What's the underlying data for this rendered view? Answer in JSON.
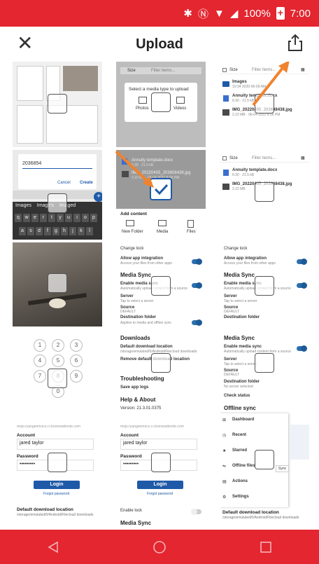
{
  "status_bar": {
    "battery": "100%",
    "time": "7:00",
    "icons": [
      "bluetooth-icon",
      "nfc-icon",
      "wifi-icon",
      "signal-icon",
      "battery-icon"
    ]
  },
  "app_bar": {
    "title": "Upload",
    "close_icon": "close-icon",
    "upload_icon": "upload-icon"
  },
  "colors": {
    "status_bar": "#e32630",
    "nav_bar": "#e32630",
    "accent": "#1e5aa8",
    "arrow": "#f0832f"
  },
  "tiles": {
    "t2": {
      "size_label": "Size",
      "filter_placeholder": "Filter items...",
      "dialog_title": "Select a media type to upload",
      "photos": "Photos",
      "videos": "Videos"
    },
    "t3": {
      "size_label": "Size",
      "filter_placeholder": "Filter items...",
      "rows": [
        {
          "name": "Images",
          "meta": "10:34 2020-06-09 AM"
        },
        {
          "name": "Annuity template.docx",
          "meta": "6:30 · 21.5 kB"
        },
        {
          "name": "IMG_20220405_203608438.jpg",
          "meta": "2.22 MB · 06-04 2022 8:36 PM"
        }
      ]
    },
    "t4": {
      "input_value": "2036854",
      "cancel": "Cancel",
      "create": "Create",
      "suggestions": [
        "Images",
        "Image's",
        "Imaged"
      ],
      "keys_row1": [
        "q",
        "w",
        "e",
        "r",
        "t",
        "y",
        "u",
        "i",
        "o",
        "p"
      ],
      "keys_row2": [
        "a",
        "s",
        "d",
        "f",
        "g",
        "h",
        "j",
        "k",
        "l"
      ]
    },
    "t5": {
      "rows": [
        {
          "name": "Annuity template.docx",
          "meta": "6:30 · 21.5 kB"
        },
        {
          "name": "IMG_20220405_203608438.jpg",
          "meta": "2.22 MB · 06-04 2022 8:36 PM"
        }
      ],
      "add_content": "Add content",
      "new_folder": "New Folder",
      "media": "Media",
      "files": "Files"
    },
    "t6": {
      "size_label": "Size",
      "filter_placeholder": "Filter items...",
      "rows": [
        {
          "name": "Annuity template.docx",
          "meta": "6:30 · 21.5 kB"
        },
        {
          "name": "IMG_20220405_203608438.jpg",
          "meta": "2.22 MB"
        }
      ]
    },
    "t8": {
      "change_lock": "Change lock",
      "allow_app": "Allow app integration",
      "allow_app_desc": "Access your files from other apps",
      "media_sync": "Media Sync",
      "enable_media_sync": "Enable media sync",
      "enable_desc": "Automatically upload content from a source",
      "server": "Server",
      "server_desc": "Tap to select a server",
      "source": "Source",
      "source_val": "DEFAULT",
      "destination": "Destination folder",
      "destination_desc": "Applies to media and offline sync"
    },
    "t9": {
      "change_lock": "Change lock",
      "allow_app": "Allow app integration",
      "allow_app_desc": "Access your files from other apps",
      "media_sync": "Media Sync",
      "enable_media_sync": "Enable media sync",
      "enable_desc": "Automatically upload content from a source",
      "server": "Server",
      "server_desc": "Tap to select a server",
      "source": "Source",
      "source_val": "DEFAULT",
      "destination": "Destination folder"
    },
    "t10": {
      "keypad": [
        "1",
        "2",
        "3",
        "4",
        "5",
        "6",
        "7",
        "8",
        "9",
        "0"
      ],
      "url": "mojo.ryangenmocs.r.r.leonoswbnote.com",
      "account_label": "Account",
      "account_value": "jared taylor",
      "password_label": "Password",
      "password_value": "•••••••••",
      "login": "Login",
      "forgot": "Forgot password",
      "default_download": "Default download location",
      "default_download_path": "/storage/emulated/0/Android/Filecloud downloads"
    },
    "t11": {
      "downloads": "Downloads",
      "default_download": "Default download location",
      "default_download_path": "/storage/emulated/0/Android/Filecloud downloads",
      "remove_default": "Remove default download location",
      "troubleshooting": "Troubleshooting",
      "save_logs": "Save app logs",
      "help": "Help & About",
      "version": "Version: 21.3.01.0375",
      "url": "mojo.ryangenmocs.r.r.leonoswbnote.com",
      "account_label": "Account",
      "account_value": "jared taylor",
      "password_label": "Password",
      "password_value": "•••••••••",
      "login": "Login",
      "forgot": "Forgot password",
      "enable_lock": "Enable lock",
      "media_sync": "Media Sync"
    },
    "t12": {
      "media_sync": "Media Sync",
      "enable_media_sync": "Enable media sync",
      "enable_desc": "Automatically upload content from a source",
      "server": "Server",
      "server_desc": "Tap to select a server",
      "source": "Source",
      "source_val": "DEFAULT",
      "destination": "Destination folder",
      "destination_desc": "No server selected",
      "check_status": "Check status",
      "offline_sync": "Offline sync",
      "menu": [
        "Dashboard",
        "Recent",
        "Starred",
        "Offline files",
        "Actions",
        "Settings"
      ],
      "sync": "Sync",
      "default_download": "Default download location",
      "default_download_path": "/storage/emulated/0/Android/Filecloud downloads"
    }
  },
  "nav_bar": {
    "back_icon": "back-triangle-icon",
    "home_icon": "home-circle-icon",
    "recents_icon": "recents-square-icon"
  }
}
